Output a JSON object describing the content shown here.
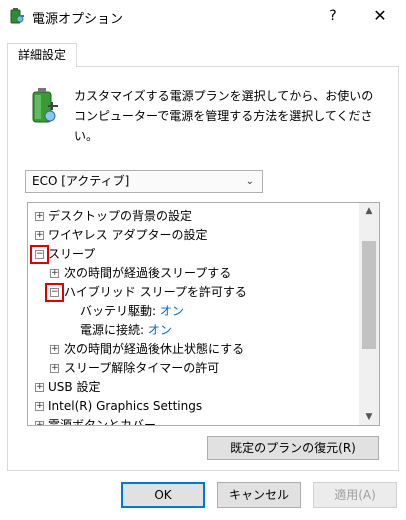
{
  "window": {
    "title": "電源オプション",
    "help": "?",
    "close": "✕"
  },
  "tab": {
    "label": "詳細設定"
  },
  "description": "カスタマイズする電源プランを選択してから、お使いのコンピューターで電源を管理する方法を選択してください。",
  "plan_select": {
    "value": "ECO [アクティブ]"
  },
  "tree": {
    "items": [
      {
        "label": "デスクトップの背景の設定",
        "expander": "+"
      },
      {
        "label": "ワイヤレス アダプターの設定",
        "expander": "+"
      },
      {
        "label": "スリープ",
        "expander": "−"
      },
      {
        "label": "次の時間が経過後スリープする",
        "expander": "+"
      },
      {
        "label": "ハイブリッド スリープを許可する",
        "expander": "−"
      },
      {
        "label": "バッテリ駆動:",
        "value": "オン"
      },
      {
        "label": "電源に接続:",
        "value": "オン"
      },
      {
        "label": "次の時間が経過後休止状態にする",
        "expander": "+"
      },
      {
        "label": "スリープ解除タイマーの許可",
        "expander": "+"
      },
      {
        "label": "USB 設定",
        "expander": "+"
      },
      {
        "label": "Intel(R) Graphics Settings",
        "expander": "+"
      },
      {
        "label": "電源ボタンとカバー",
        "expander": "+"
      }
    ]
  },
  "buttons": {
    "restore": "既定のプランの復元(R)",
    "ok": "OK",
    "cancel": "キャンセル",
    "apply": "適用(A)"
  },
  "icons": {
    "app": "power-options-icon",
    "battery": "battery-plug-icon"
  },
  "colors": {
    "value_link": "#0066cc",
    "highlight": "#e00000",
    "focus": "#0078d7"
  }
}
